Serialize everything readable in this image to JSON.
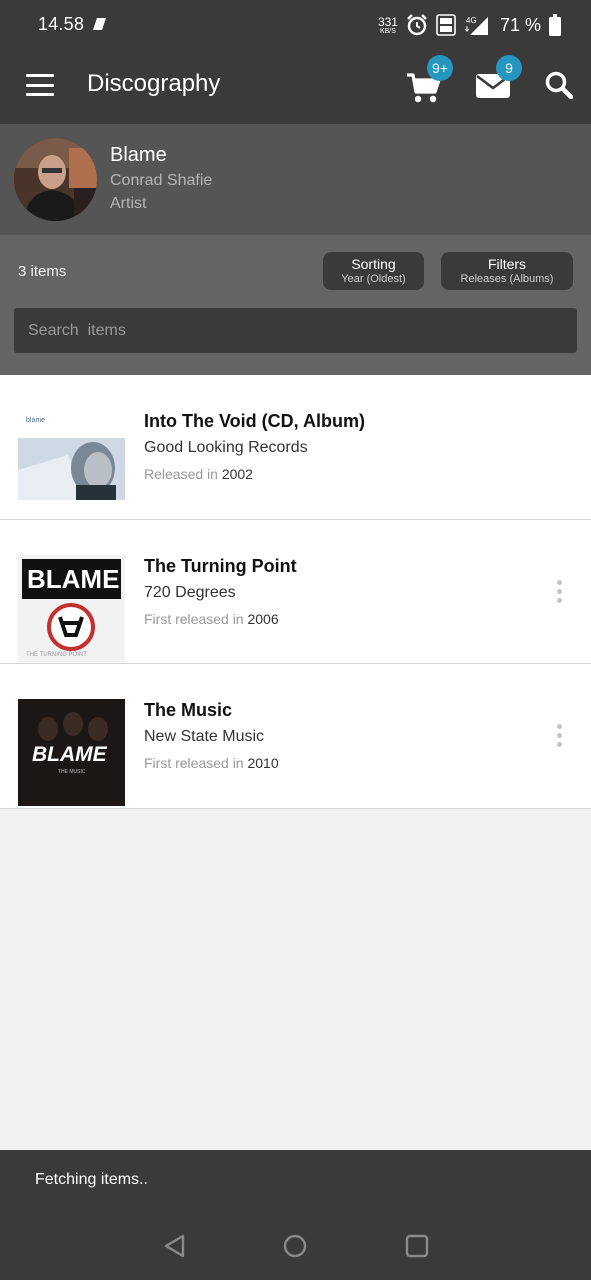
{
  "status_bar": {
    "time": "14.58",
    "net_speed_value": "331",
    "net_speed_unit": "KB/S",
    "battery_percent": "71 %"
  },
  "app_bar": {
    "title": "Discography",
    "cart_badge": "9+",
    "mail_badge": "9",
    "icons": [
      "menu-icon",
      "cart-icon",
      "mail-icon",
      "search-icon"
    ]
  },
  "artist": {
    "name": "Blame",
    "real_name": "Conrad Shafie",
    "role": "Artist"
  },
  "toolbar": {
    "items_count": "3 items",
    "sorting_label": "Sorting",
    "sorting_value": "Year (Oldest)",
    "filters_label": "Filters",
    "filters_value": "Releases (Albums)",
    "search_placeholder": "Search  items"
  },
  "releases": [
    {
      "title": "Into The Void (CD, Album)",
      "label": "Good Looking Records",
      "date_prefix": "Released in",
      "year": "2002",
      "has_menu": false
    },
    {
      "title": "The Turning Point",
      "label": "720 Degrees",
      "date_prefix": "First released in",
      "year": "2006",
      "has_menu": true
    },
    {
      "title": "The Music",
      "label": "New State Music",
      "date_prefix": "First released in",
      "year": "2010",
      "has_menu": true
    }
  ],
  "snackbar": {
    "text": "Fetching items.."
  },
  "colors": {
    "bar_dark": "#3a3a3a",
    "artist_header": "#555555",
    "toolbar": "#646464",
    "badge": "#2596be",
    "list_bg": "#ffffff",
    "page_bg": "#f0f0f0"
  }
}
